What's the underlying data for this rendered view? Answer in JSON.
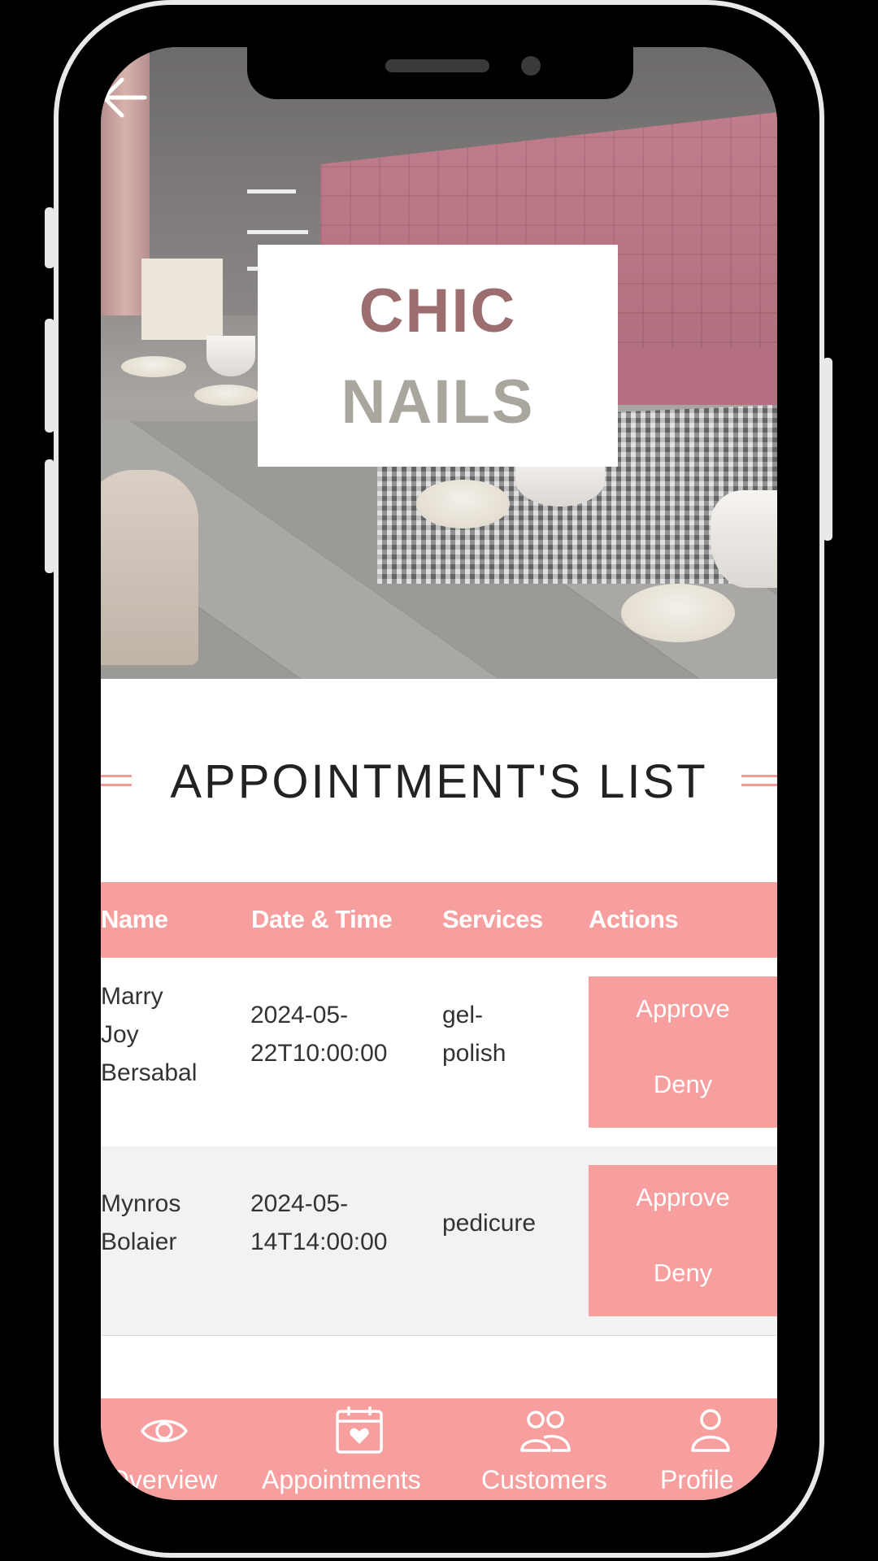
{
  "hero": {
    "logo_line1": "CHIC",
    "logo_line2": "NAILS"
  },
  "page_title": "APPOINTMENT'S LIST",
  "table": {
    "headers": [
      "Name",
      "Date & Time",
      "Services",
      "Actions"
    ],
    "rows": [
      {
        "name_lines": [
          "Marry",
          "Joy",
          "Bersabal"
        ],
        "datetime_lines": [
          "2024-05-",
          "22T10:00:00"
        ],
        "service_lines": [
          "gel-",
          "polish"
        ],
        "approve_label": "Approve",
        "deny_label": "Deny"
      },
      {
        "name_lines": [
          "Mynros",
          "Bolaier"
        ],
        "datetime_lines": [
          "2024-05-",
          "14T14:00:00"
        ],
        "service_lines": [
          "pedicure"
        ],
        "approve_label": "Approve",
        "deny_label": "Deny"
      }
    ]
  },
  "bottom_nav": {
    "items": [
      {
        "label": "Overview",
        "icon": "eye-icon"
      },
      {
        "label": "Appointments",
        "icon": "calendar-heart-icon"
      },
      {
        "label": "Customers",
        "icon": "users-icon"
      },
      {
        "label": "Profile",
        "icon": "user-icon"
      }
    ]
  },
  "colors": {
    "accent": "#f79e9e",
    "frame": "#e9e9e9",
    "background": "#000000"
  }
}
